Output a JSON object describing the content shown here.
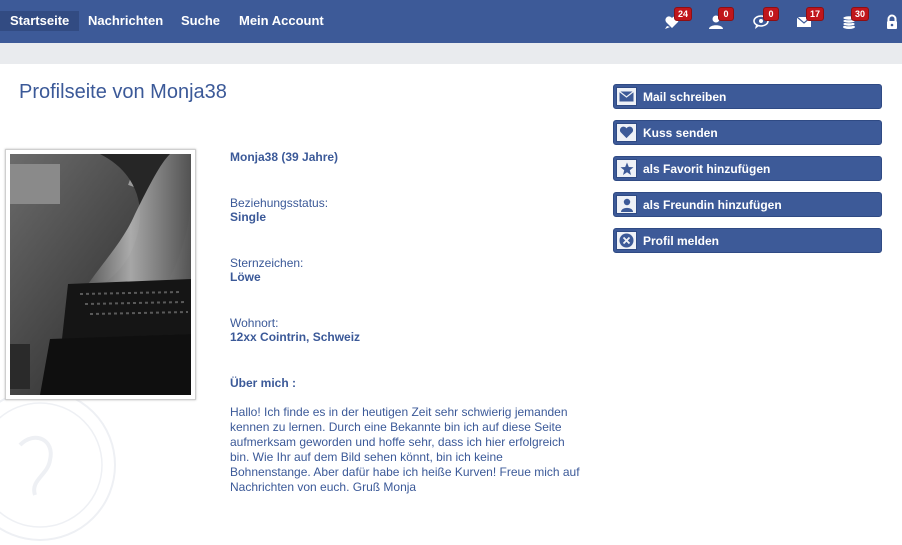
{
  "nav": {
    "items": [
      {
        "label": "Startseite",
        "active": true
      },
      {
        "label": "Nachrichten"
      },
      {
        "label": "Suche"
      },
      {
        "label": "Mein Account"
      }
    ]
  },
  "notifications": [
    {
      "icon": "heart-chat-icon",
      "count": "24"
    },
    {
      "icon": "user-icon",
      "count": "0"
    },
    {
      "icon": "eye-chat-icon",
      "count": "0"
    },
    {
      "icon": "envelope-icon",
      "count": "17"
    },
    {
      "icon": "coins-icon",
      "count": "30"
    },
    {
      "icon": "lock-icon"
    }
  ],
  "page": {
    "title": "Profilseite von Monja38"
  },
  "profile": {
    "name_age": "Monja38 (39 Jahre)",
    "relationship_label": "Beziehungsstatus:",
    "relationship_value": "Single",
    "zodiac_label": "Sternzeichen:",
    "zodiac_value": "Löwe",
    "location_label": "Wohnort:",
    "location_value": "12xx Cointrin, Schweiz",
    "about_label": "Über mich :",
    "about_text": "Hallo! Ich finde es in der heutigen Zeit sehr schwierig jemanden kennen zu lernen. Durch eine Bekannte bin ich auf diese Seite aufmerksam geworden und hoffe sehr, dass ich hier erfolgreich bin. Wie Ihr auf dem Bild sehen könnt, bin ich keine Bohnenstange. Aber dafür habe ich heiße Kurven! Freue mich auf Nachrichten von euch. Gruß Monja"
  },
  "actions": [
    {
      "label": "Mail schreiben",
      "icon": "envelope-icon"
    },
    {
      "label": "Kuss senden",
      "icon": "heart-icon"
    },
    {
      "label": "als Favorit hinzufügen",
      "icon": "star-icon"
    },
    {
      "label": "als Freundin hinzufügen",
      "icon": "user-icon"
    },
    {
      "label": "Profil melden",
      "icon": "close-circle-icon"
    }
  ],
  "colors": {
    "navbar": "#3d5a98",
    "badge": "#c0161c",
    "text": "#3b5998"
  }
}
